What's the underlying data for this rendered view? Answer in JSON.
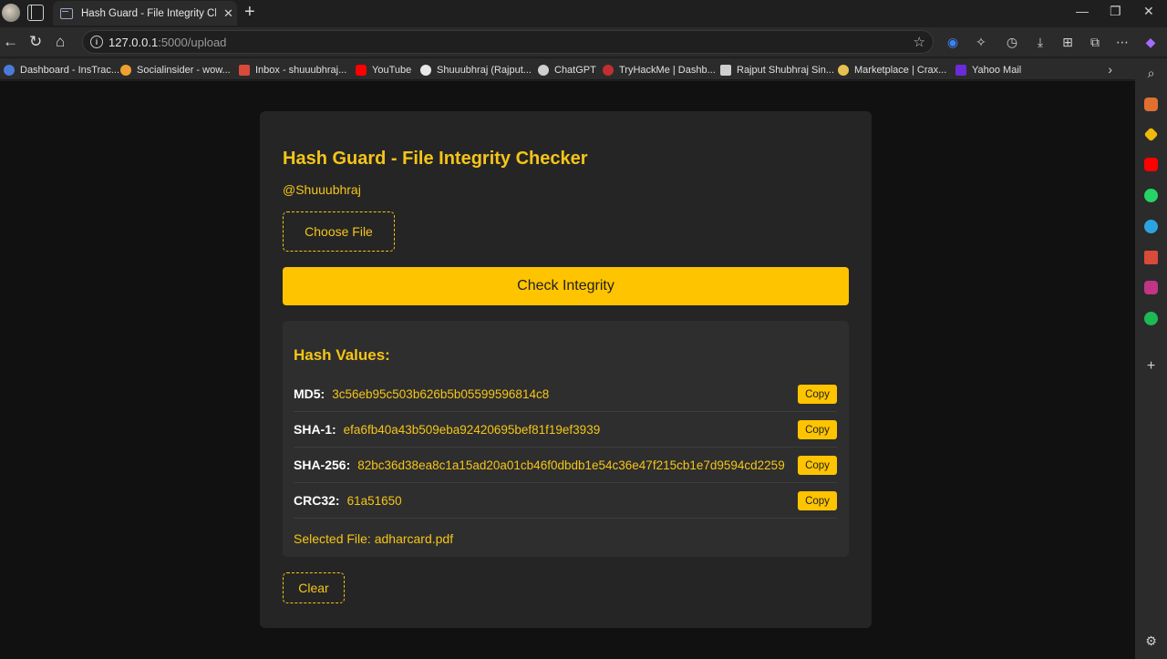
{
  "browser": {
    "tab_title": "Hash Guard - File Integrity Checker",
    "url_host": "127.0.0.1",
    "url_path": ":5000/upload"
  },
  "bookmarks": [
    {
      "label": "Dashboard - InsTrac...",
      "color": "#4a7bd8"
    },
    {
      "label": "Socialinsider - wow...",
      "color": "#f0a030"
    },
    {
      "label": "Inbox - shuuubhraj...",
      "color": "#d84a3a"
    },
    {
      "label": "YouTube",
      "color": "#ff0000"
    },
    {
      "label": "Shuuubhraj (Rajput...",
      "color": "#e8e8e8"
    },
    {
      "label": "ChatGPT",
      "color": "#cfcfcf"
    },
    {
      "label": "TryHackMe | Dashb...",
      "color": "#c03030"
    },
    {
      "label": "Rajput Shubhraj Sin...",
      "color": "#cfcfcf"
    },
    {
      "label": "Marketplace | Crax...",
      "color": "#e8c050"
    },
    {
      "label": "Yahoo Mail",
      "color": "#6a2bd8"
    }
  ],
  "app": {
    "title": "Hash Guard - File Integrity Checker",
    "handle": "@Shuuubhraj",
    "choose_file_label": "Choose File",
    "check_label": "Check Integrity",
    "hash_heading": "Hash Values:",
    "hashes": [
      {
        "label": "MD5:",
        "value": "3c56eb95c503b626b5b05599596814c8",
        "copy": "Copy"
      },
      {
        "label": "SHA-1:",
        "value": "efa6fb40a43b509eba92420695bef81f19ef3939",
        "copy": "Copy"
      },
      {
        "label": "SHA-256:",
        "value": "82bc36d38ea8c1a15ad20a01cb46f0dbdb1e54c36e47f215cb1e7d9594cd2259",
        "copy": "Copy"
      },
      {
        "label": "CRC32:",
        "value": "61a51650",
        "copy": "Copy"
      }
    ],
    "selected_file": "Selected File: adharcard.pdf",
    "clear_label": "Clear"
  }
}
